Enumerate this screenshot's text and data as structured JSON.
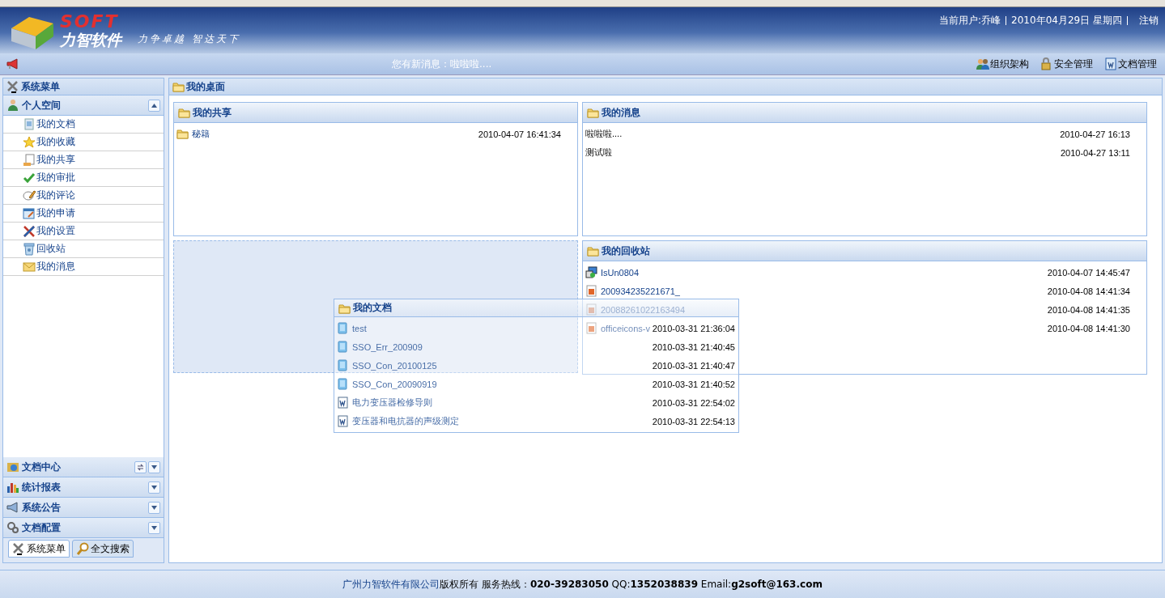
{
  "header": {
    "logo_mark": "SOFT",
    "logo_text": "力智软件",
    "slogan": "力争卓越 智达天下",
    "user": "当前用户:乔峰",
    "date": "2010年04月29日 星期四",
    "logout": "注销"
  },
  "message_bar": {
    "message": "您有新消息：啦啦啦....",
    "links": [
      "组织架构",
      "安全管理",
      "文档管理"
    ]
  },
  "sidebar": {
    "title": "系统菜单",
    "sections": [
      {
        "title": "个人空间",
        "expanded": true,
        "refresh": false,
        "items": [
          "我的文档",
          "我的收藏",
          "我的共享",
          "我的审批",
          "我的评论",
          "我的申请",
          "我的设置",
          "回收站",
          "我的消息"
        ]
      },
      {
        "title": "文档中心",
        "expanded": false,
        "refresh": true
      },
      {
        "title": "统计报表",
        "expanded": false,
        "refresh": false
      },
      {
        "title": "系统公告",
        "expanded": false,
        "refresh": false
      },
      {
        "title": "文档配置",
        "expanded": false,
        "refresh": false
      }
    ],
    "tabs": [
      {
        "label": "系统菜单",
        "selected": true
      },
      {
        "label": "全文搜索",
        "selected": false
      }
    ]
  },
  "desktop": {
    "title": "我的桌面",
    "columns": [
      {
        "portlets": [
          {
            "kind": "portlet",
            "title": "我的共享",
            "items": [
              {
                "kind": "folder",
                "name": "秘籍",
                "time": "2010-04-07 16:41:34"
              }
            ]
          },
          {
            "kind": "drop-placeholder"
          }
        ]
      },
      {
        "portlets": [
          {
            "kind": "portlet",
            "title": "我的消息",
            "items": [
              {
                "kind": "message",
                "name": "啦啦啦....",
                "time": "2010-04-27 16:13"
              },
              {
                "kind": "message",
                "name": "测试啦",
                "time": "2010-04-27 13:11"
              }
            ]
          },
          {
            "kind": "portlet",
            "title": "我的回收站",
            "items": [
              {
                "kind": "setup",
                "name": "IsUn0804",
                "time": "2010-04-07 14:45:47"
              },
              {
                "kind": "image",
                "name": "200934235221671_",
                "time": "2010-04-08 14:41:34"
              },
              {
                "kind": "image",
                "name": "20088261022163494",
                "time": "2010-04-08 14:41:35"
              },
              {
                "kind": "image",
                "name": "officeicons-v",
                "time": "2010-04-08 14:41:30"
              }
            ]
          }
        ]
      }
    ],
    "dragged_portlet": {
      "title": "我的文档",
      "items": [
        {
          "kind": "document",
          "name": "test",
          "time": "2010-03-31 21:36:04"
        },
        {
          "kind": "document",
          "name": "SSO_Err_200909",
          "time": "2010-03-31 21:40:45"
        },
        {
          "kind": "document",
          "name": "SSO_Con_20100125",
          "time": "2010-03-31 21:40:47"
        },
        {
          "kind": "document",
          "name": "SSO_Con_20090919",
          "time": "2010-03-31 21:40:52"
        },
        {
          "kind": "word",
          "name": "电力变压器检修导则",
          "time": "2010-03-31 22:54:02"
        },
        {
          "kind": "word",
          "name": "变压器和电抗器的声级测定",
          "time": "2010-03-31 22:54:13"
        }
      ]
    }
  },
  "footer": {
    "company": "广州力智软件有限公司",
    "text": "版权所有 服务热线：**020-39283050** QQ:**1352038839** Email:**g2soft@163.com**"
  }
}
